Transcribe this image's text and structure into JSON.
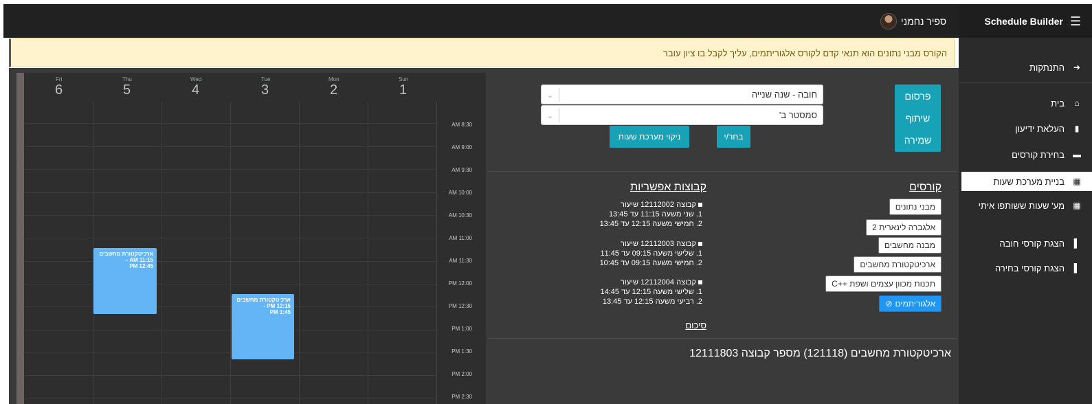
{
  "user": {
    "name": "ספיר נחמני"
  },
  "sidebar": {
    "brand": "Schedule Builder",
    "items": [
      {
        "label": "התנתקות",
        "icon": "sign-out-icon"
      },
      {
        "label": "בית",
        "icon": "home-icon"
      },
      {
        "label": "העלאת ידיעון",
        "icon": "file-upload-icon"
      },
      {
        "label": "בחירת קורסים",
        "icon": "inbox-icon"
      },
      {
        "label": "בניית מערכת שעות",
        "icon": "calendar-icon",
        "active": true
      },
      {
        "label": "מע' שעות ששותפו איתי",
        "icon": "calendar-shared-icon"
      },
      {
        "label": "הצגת קורסי חובה",
        "icon": "bookmark-icon"
      },
      {
        "label": "הצגת קורסי בחירה",
        "icon": "bookmark-icon"
      }
    ]
  },
  "banner": {
    "text": "הקורס מבני נתונים הוא תנאי קדם לקורס אלגוריתמים, עליך לקבל בו ציון עובר"
  },
  "calendar": {
    "days": [
      {
        "name": "Fri",
        "num": "6"
      },
      {
        "name": "Thu",
        "num": "5"
      },
      {
        "name": "Wed",
        "num": "4"
      },
      {
        "name": "Tue",
        "num": "3"
      },
      {
        "name": "Mon",
        "num": "2"
      },
      {
        "name": "Sun",
        "num": "1"
      }
    ],
    "times": [
      "AM 8:30",
      "AM 9:00",
      "AM 9:30",
      "AM 10:00",
      "AM 10:30",
      "AM 11:00",
      "AM 11:30",
      "PM 12:00",
      "PM 12:30",
      "PM 1:00",
      "PM 1:30",
      "PM 2:00",
      "PM 2:30"
    ],
    "events": [
      {
        "title": "ארכיטקטורת מחשבים",
        "start": "AM 11:15 -",
        "end": "PM 12:45",
        "day": "Thu"
      },
      {
        "title": "ארכיטקטורת מחשבים",
        "start": "PM 12:15 -",
        "end": "PM 1:45",
        "day": "Tue"
      }
    ]
  },
  "controls": {
    "select_year": "חובה - שנה שנייה",
    "select_semester": "סמסטר ב'",
    "choose_button": "בחר/י",
    "clear_button": "ניקוי מערכת שעות",
    "publish_button": "פרסום",
    "share_button": "שיתוף",
    "save_button": "שמירה"
  },
  "courses": {
    "title": "קורסים",
    "items": [
      {
        "label": "מבני נתונים"
      },
      {
        "label": "אלגברה לינארית 2"
      },
      {
        "label": "מבנה מחשבים"
      },
      {
        "label": "ארכיטקטורת מחשבים"
      },
      {
        "label": "תכנות מכוון עצמים ושפת ++C"
      },
      {
        "label": "אלגוריתמים",
        "active": true,
        "icon": "check-circle-icon"
      }
    ]
  },
  "groups": {
    "title": "קבוצות אפשריות",
    "items": [
      {
        "header": "קבוצה 12112002 שיעור",
        "lines": [
          "1. שני משעה 11:15 עד 13:45",
          "2. חמישי משעה 12:15 עד 13:45"
        ]
      },
      {
        "header": "קבוצה 12112003 שיעור",
        "lines": [
          "1. שלישי משעה 09:15 עד 11:45",
          "2. חמישי משעה 09:15 עד 10:45"
        ]
      },
      {
        "header": "קבוצה 12112004 שיעור",
        "lines": [
          "1. שלישי משעה 12:15 עד 14:45",
          "2. רביעי משעה 12:15 עד 13:45"
        ]
      }
    ],
    "summary_link": "סיכום"
  },
  "selected": {
    "text": "ארכיטקטורת מחשבים (121118) מספר קבוצה 12111803"
  },
  "colors": {
    "event": "#64b5f6",
    "teal": "#17a2b8",
    "active_course": "#2196f3",
    "banner_bg": "#fff3cd"
  }
}
